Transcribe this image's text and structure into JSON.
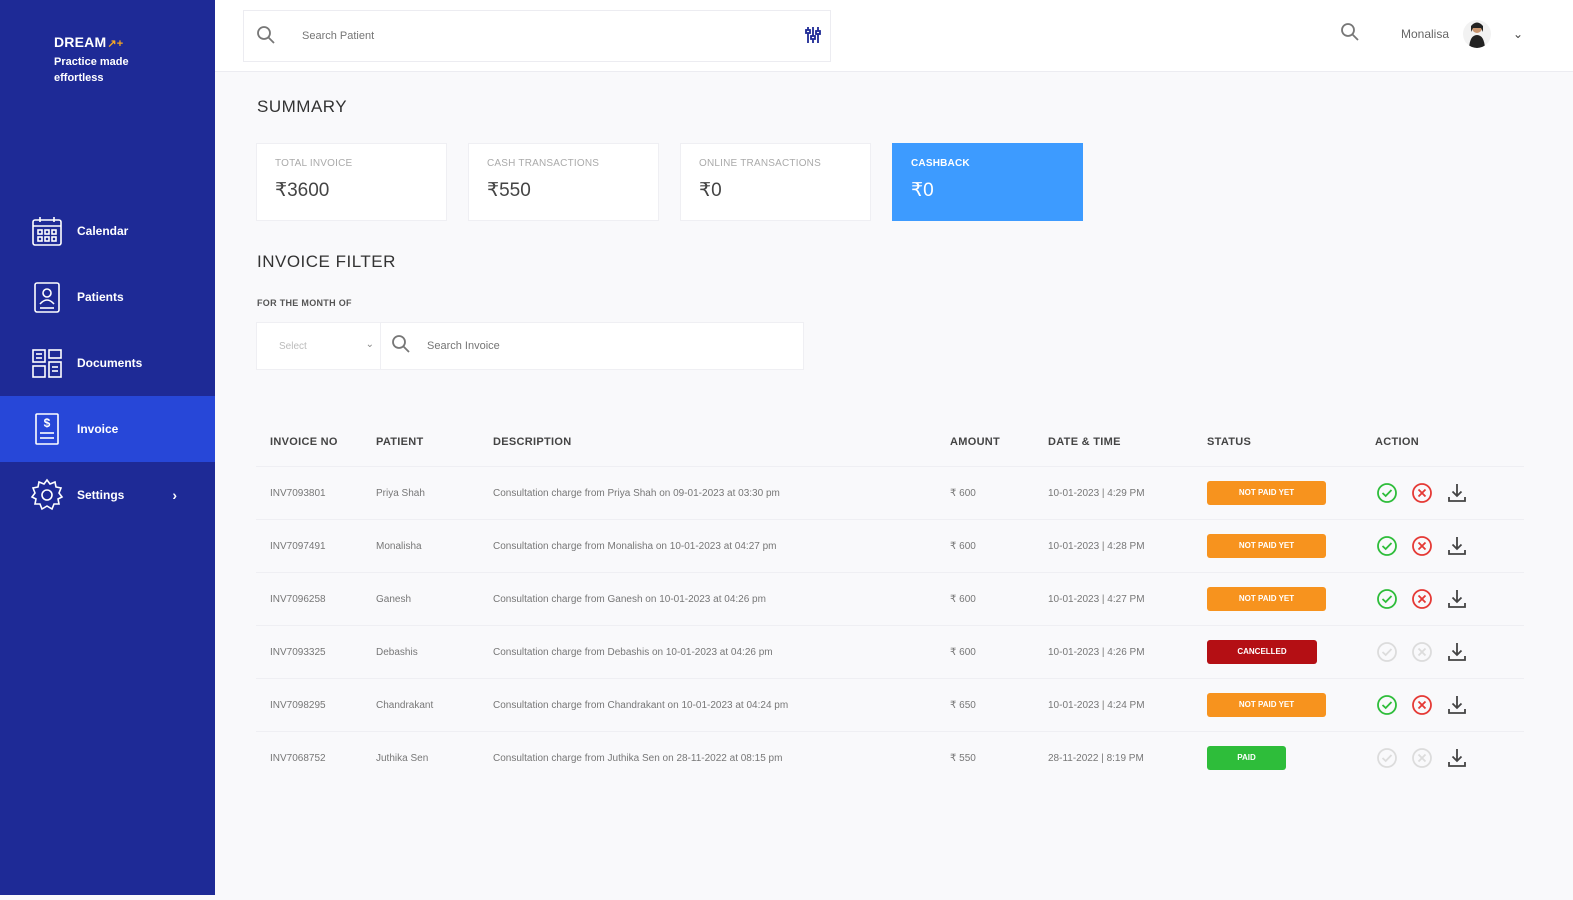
{
  "brand": {
    "name": "DREAM",
    "tagline": "Practice made effortless"
  },
  "sidebar": {
    "items": [
      {
        "label": "Calendar",
        "icon": "calendar-icon",
        "active": false
      },
      {
        "label": "Patients",
        "icon": "patients-icon",
        "active": false
      },
      {
        "label": "Documents",
        "icon": "documents-icon",
        "active": false
      },
      {
        "label": "Invoice",
        "icon": "invoice-icon",
        "active": true
      },
      {
        "label": "Settings",
        "icon": "gear-icon",
        "active": false
      }
    ]
  },
  "topbar": {
    "search_placeholder": "Search Patient",
    "user_name": "Monalisa"
  },
  "summary": {
    "title": "SUMMARY",
    "cards": [
      {
        "label": "TOTAL INVOICE",
        "value": "₹3600"
      },
      {
        "label": "CASH TRANSACTIONS",
        "value": "₹550"
      },
      {
        "label": "ONLINE TRANSACTIONS",
        "value": "₹0"
      },
      {
        "label": "CASHBACK",
        "value": "₹0"
      }
    ]
  },
  "invoice_filter": {
    "title": "INVOICE FILTER",
    "month_label": "FOR THE MONTH OF",
    "select_placeholder": "Select",
    "search_placeholder": "Search Invoice"
  },
  "table": {
    "headers": {
      "invoice_no": "INVOICE NO",
      "patient": "PATIENT",
      "description": "DESCRIPTION",
      "amount": "AMOUNT",
      "date_time": "DATE & TIME",
      "status": "STATUS",
      "action": "ACTION"
    },
    "rows": [
      {
        "invoice_no": "INV7093801",
        "patient": "Priya Shah",
        "description": "Consultation charge from Priya Shah on 09-01-2023 at 03:30 pm",
        "amount": "₹ 600",
        "date_time": "10-01-2023 | 4:29 PM",
        "status": "NOT PAID YET"
      },
      {
        "invoice_no": "INV7097491",
        "patient": "Monalisha",
        "description": "Consultation charge from Monalisha on 10-01-2023 at 04:27 pm",
        "amount": "₹ 600",
        "date_time": "10-01-2023 | 4:28 PM",
        "status": "NOT PAID YET"
      },
      {
        "invoice_no": "INV7096258",
        "patient": "Ganesh",
        "description": "Consultation charge from Ganesh on 10-01-2023 at 04:26 pm",
        "amount": "₹ 600",
        "date_time": "10-01-2023 | 4:27 PM",
        "status": "NOT PAID YET"
      },
      {
        "invoice_no": "INV7093325",
        "patient": "Debashis",
        "description": "Consultation charge from Debashis on 10-01-2023 at 04:26 pm",
        "amount": "₹ 600",
        "date_time": "10-01-2023 | 4:26 PM",
        "status": "CANCELLED"
      },
      {
        "invoice_no": "INV7098295",
        "patient": "Chandrakant",
        "description": "Consultation charge from Chandrakant on 10-01-2023 at 04:24 pm",
        "amount": "₹ 650",
        "date_time": "10-01-2023 | 4:24 PM",
        "status": "NOT PAID YET"
      },
      {
        "invoice_no": "INV7068752",
        "patient": "Juthika Sen",
        "description": "Consultation charge from Juthika Sen on 28-11-2022 at 08:15 pm",
        "amount": "₹ 550",
        "date_time": "28-11-2022 | 8:19 PM",
        "status": "PAID"
      }
    ]
  },
  "colors": {
    "sidebar_bg": "#1e2a96",
    "sidebar_active": "#2747d8",
    "highlight_card": "#3d9bff",
    "not_paid": "#f7931e",
    "cancelled": "#b40f14",
    "paid": "#2ebd3a",
    "approve": "#2ebd3a",
    "reject": "#e53935"
  }
}
